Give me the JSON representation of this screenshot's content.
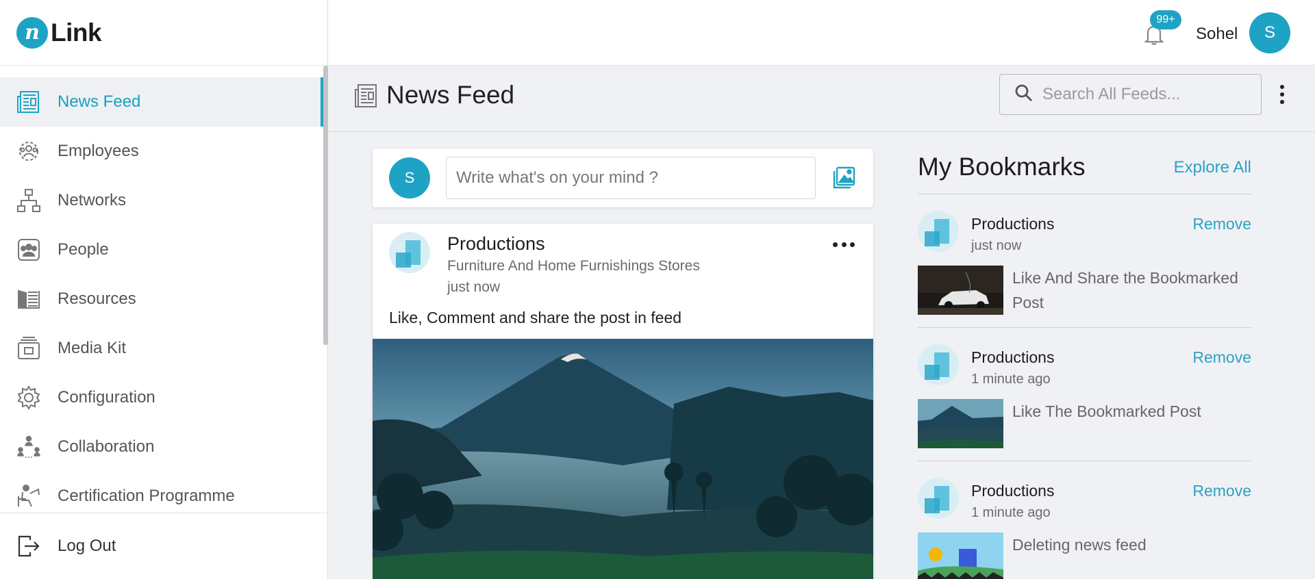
{
  "app": {
    "logo_letter": "n",
    "logo_text": "Link"
  },
  "sidebar": {
    "items": [
      {
        "label": "News Feed",
        "icon": "news-feed-icon",
        "active": true
      },
      {
        "label": "Employees",
        "icon": "employees-icon"
      },
      {
        "label": "Networks",
        "icon": "networks-icon"
      },
      {
        "label": "People",
        "icon": "people-icon"
      },
      {
        "label": "Resources",
        "icon": "resources-icon"
      },
      {
        "label": "Media Kit",
        "icon": "media-kit-icon"
      },
      {
        "label": "Configuration",
        "icon": "gear-icon"
      },
      {
        "label": "Collaboration",
        "icon": "collaboration-icon"
      },
      {
        "label": "Certification Programme",
        "icon": "certification-icon"
      }
    ],
    "logout_label": "Log Out"
  },
  "topbar": {
    "notification_count": "99+",
    "user_name": "Sohel",
    "user_initial": "S"
  },
  "page": {
    "title": "News Feed",
    "search_placeholder": "Search All Feeds..."
  },
  "composer": {
    "avatar_initial": "S",
    "placeholder": "Write what's on your mind ?"
  },
  "post": {
    "author": "Productions",
    "category": "Furniture And Home Furnishings Stores",
    "time": "just now",
    "text": "Like, Comment and share the post in feed"
  },
  "bookmarks": {
    "title": "My Bookmarks",
    "explore_label": "Explore All",
    "items": [
      {
        "author": "Productions",
        "time": "just now",
        "remove_label": "Remove",
        "text": "Like And Share the Bookmarked Post"
      },
      {
        "author": "Productions",
        "time": "1 minute ago",
        "remove_label": "Remove",
        "text": "Like The Bookmarked Post"
      },
      {
        "author": "Productions",
        "time": "1 minute ago",
        "remove_label": "Remove",
        "text": "Deleting news feed"
      }
    ]
  },
  "colors": {
    "accent": "#1fa3c4",
    "link": "#2aa3c3",
    "background": "#f0f1f4"
  }
}
